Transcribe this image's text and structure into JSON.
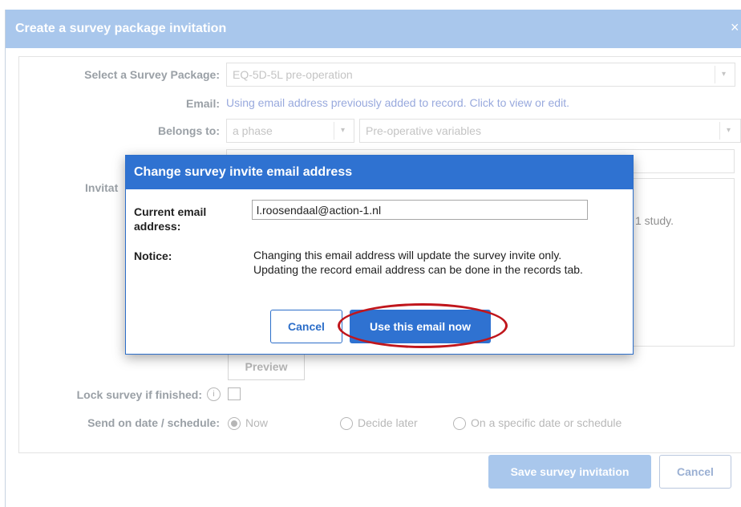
{
  "dialog": {
    "title": "Create a survey package invitation",
    "close": "×"
  },
  "form": {
    "package_label": "Select a Survey Package:",
    "package_value": "EQ-5D-5L pre-operation",
    "email_label": "Email:",
    "email_link": "Using email address previously added to record. Click to view or edit.",
    "belongs_label": "Belongs to:",
    "belongs_phase": "a phase",
    "belongs_variable": "Pre-operative variables",
    "invitation_label_partial": "Invitat",
    "study_text_partial": "1 study.",
    "preview_label": "Preview",
    "lock_label": "Lock survey if finished:",
    "lock_info": "i",
    "send_label": "Send on date / schedule:",
    "send_options": [
      "Now",
      "Decide later",
      "On a specific date or schedule"
    ],
    "send_selected": "Now",
    "save_label": "Save survey invitation",
    "cancel_label": "Cancel"
  },
  "modal": {
    "title": "Change survey invite email address",
    "current_email_label_1": "Current email",
    "current_email_label_2": "address:",
    "current_email_value": "l.roosendaal@action-1.nl",
    "notice_label": "Notice:",
    "notice_text": "Changing this email address will update the survey invite only. Updating the record email address can be done in the records tab.",
    "cancel_label": "Cancel",
    "use_label": "Use this email now"
  },
  "colors": {
    "modal_primary": "#2f72d1",
    "dimmed_header": "#a9c7ec",
    "highlight": "#c0161c"
  }
}
